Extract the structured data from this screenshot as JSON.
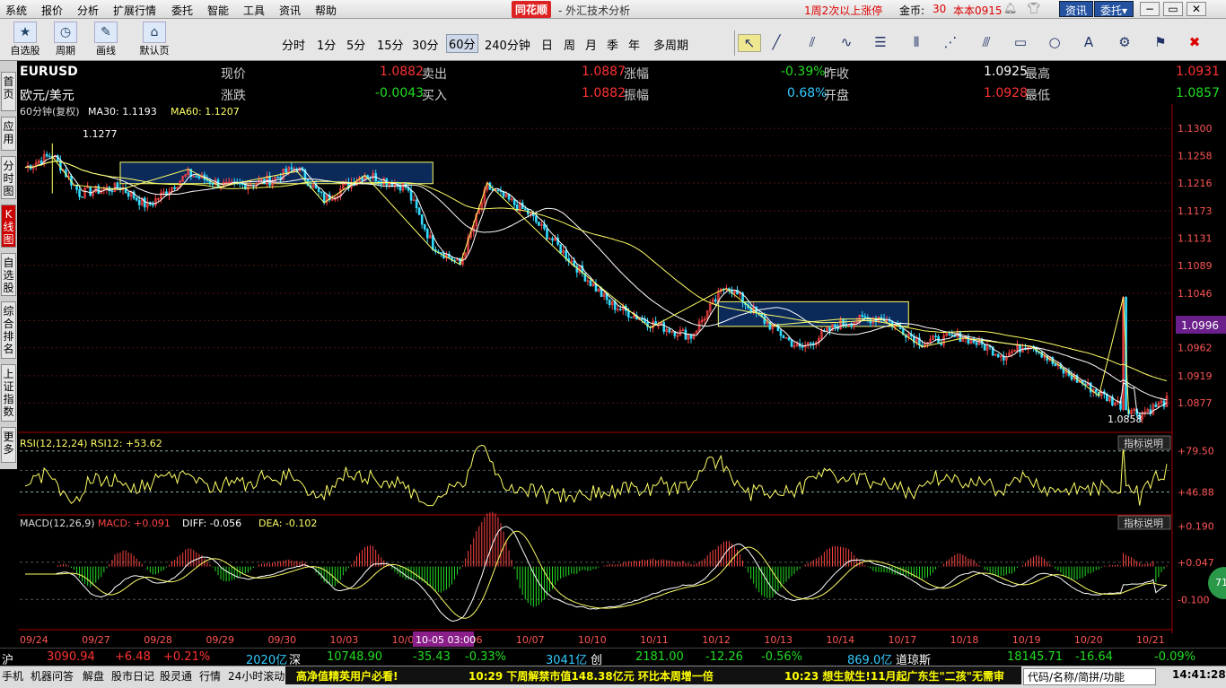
{
  "menu": [
    "系统",
    "报价",
    "分析",
    "扩展行情",
    "委托",
    "智能",
    "工具",
    "资讯",
    "帮助"
  ],
  "brand": "同花顺",
  "app_title": "- 外汇技术分析",
  "promo": "1周2次以上涨停",
  "coin_label": "金币:",
  "coin_value": "30",
  "account": "本本0915",
  "btn_news": "资讯",
  "btn_trade": "委托▾",
  "toolbar": {
    "zixuan": "自选股",
    "zhouqi": "周期",
    "huaxian": "画线",
    "moren": "默认页",
    "periods": [
      "分时",
      "1分",
      "5分",
      "15分",
      "30分",
      "60分",
      "240分钟",
      "日",
      "周",
      "月",
      "季",
      "年",
      "多周期"
    ],
    "selected": "60分"
  },
  "sidetabs": [
    "首页",
    "应用",
    "分时图",
    "K线图",
    "自选股",
    "综合排名",
    "上证指数",
    "更多"
  ],
  "quote": {
    "symbol": "EURUSD",
    "name": "欧元/美元",
    "xianjia_l": "现价",
    "xianjia": "1.0882",
    "maichu_l": "卖出",
    "maichu": "1.0887",
    "zhangfu_l": "涨幅",
    "zhangfu": "-0.39%",
    "zuoshou_l": "昨收",
    "zuoshou": "1.0925",
    "zuigao_l": "最高",
    "zuigao": "1.0931",
    "zhangdie_l": "涨跌",
    "zhangdie": "-0.0043",
    "mairu_l": "买入",
    "mairu": "1.0882",
    "zhenfu_l": "振幅",
    "zhenfu": "0.68%",
    "kaipan_l": "开盘",
    "kaipan": "1.0928",
    "zuidi_l": "最低",
    "zuidi": "1.0857"
  },
  "ma_info": {
    "label": "60分钟(复权)",
    "ma30": "MA30: 1.1193",
    "ma60": "MA60: 1.1207"
  },
  "price_ticks": [
    "1.1300",
    "1.1258",
    "1.1216",
    "1.1173",
    "1.1131",
    "1.1089",
    "1.1046",
    "1.1004",
    "1.0962",
    "1.0919",
    "1.0877"
  ],
  "current_price_tag": "1.0996",
  "high_mark": "1.1277",
  "low_mark": "1.0858",
  "rsi_info": "RSI(12,12,24) RSI12: +53.62",
  "rsi_ticks": [
    "+79.50",
    "+46.88"
  ],
  "macd_info": {
    "label": "MACD(12,26,9)",
    "macd": "MACD: +0.091",
    "diff": "DIFF: -0.056",
    "dea": "DEA: -0.102"
  },
  "macd_ticks": [
    "+0.190",
    "+0.047",
    "-0.100"
  ],
  "indicator_help": "指标说明",
  "dates": [
    "09/24",
    "09/27",
    "09/28",
    "09/29",
    "09/30",
    "10/03",
    "10/04",
    "10/06",
    "10/07",
    "10/10",
    "10/11",
    "10/12",
    "10/13",
    "10/14",
    "10/17",
    "10/18",
    "10/19",
    "10/20",
    "10/21"
  ],
  "cursor_date": "10-05 03:00",
  "status": {
    "sh": "沪",
    "sh_v": "3090.94",
    "sh_c": "+6.48",
    "sh_p": "+0.21%",
    "sh_amt": "2020亿",
    "sz": "深",
    "sz_v": "10748.90",
    "sz_c": "-35.43",
    "sz_p": "-0.33%",
    "sz_amt": "3041亿",
    "cy": "创",
    "cy_v": "2181.00",
    "cy_c": "-12.26",
    "cy_p": "-0.56%",
    "cy_amt": "869.0亿",
    "dj": "道琼斯",
    "dj_v": "18145.71",
    "dj_c": "-16.64",
    "dj_p": "-0.09%"
  },
  "bottom": {
    "items": [
      "手机",
      "机器问答",
      "解盘",
      "股市日记",
      "股灵通",
      "行情",
      "24小时滚动"
    ],
    "ticker": [
      "高净值精英用户必看!",
      "10:29 下周解禁市值148.38亿元 环比本周增一倍",
      "10:23 想生就生!11月起广东生\"二孩\"无需审"
    ],
    "search": "代码/名称/简拼/功能",
    "clock": "14:41:28"
  },
  "colors": {
    "up": "#ff3333",
    "down": "#22dd22",
    "bull_candle": "#ff4444",
    "bear_candle": "#33ddff",
    "ma": "#ffff66",
    "box_fill": "#0b2a5a"
  },
  "chart_data": {
    "type": "candlestick",
    "symbol": "EURUSD",
    "interval": "60分",
    "ylim": [
      1.084,
      1.131
    ],
    "anchors": [
      [
        0,
        1.124
      ],
      [
        10,
        1.126
      ],
      [
        20,
        1.12
      ],
      [
        35,
        1.121
      ],
      [
        45,
        1.118
      ],
      [
        60,
        1.123
      ],
      [
        75,
        1.121
      ],
      [
        90,
        1.122
      ],
      [
        100,
        1.124
      ],
      [
        110,
        1.119
      ],
      [
        125,
        1.123
      ],
      [
        140,
        1.121
      ],
      [
        150,
        1.112
      ],
      [
        160,
        1.109
      ],
      [
        170,
        1.121
      ],
      [
        185,
        1.117
      ],
      [
        200,
        1.11
      ],
      [
        215,
        1.103
      ],
      [
        230,
        1.1
      ],
      [
        245,
        1.098
      ],
      [
        258,
        1.106
      ],
      [
        270,
        1.101
      ],
      [
        285,
        1.096
      ],
      [
        300,
        1.1
      ],
      [
        315,
        1.101
      ],
      [
        330,
        1.097
      ],
      [
        345,
        1.098
      ],
      [
        360,
        1.095
      ],
      [
        370,
        1.097
      ],
      [
        380,
        1.093
      ],
      [
        400,
        1.088
      ],
      [
        410,
        1.086
      ],
      [
        420,
        1.088
      ]
    ],
    "rsi_ylim": [
      30,
      90
    ],
    "macd_ylim": [
      -0.17,
      0.22
    ]
  }
}
